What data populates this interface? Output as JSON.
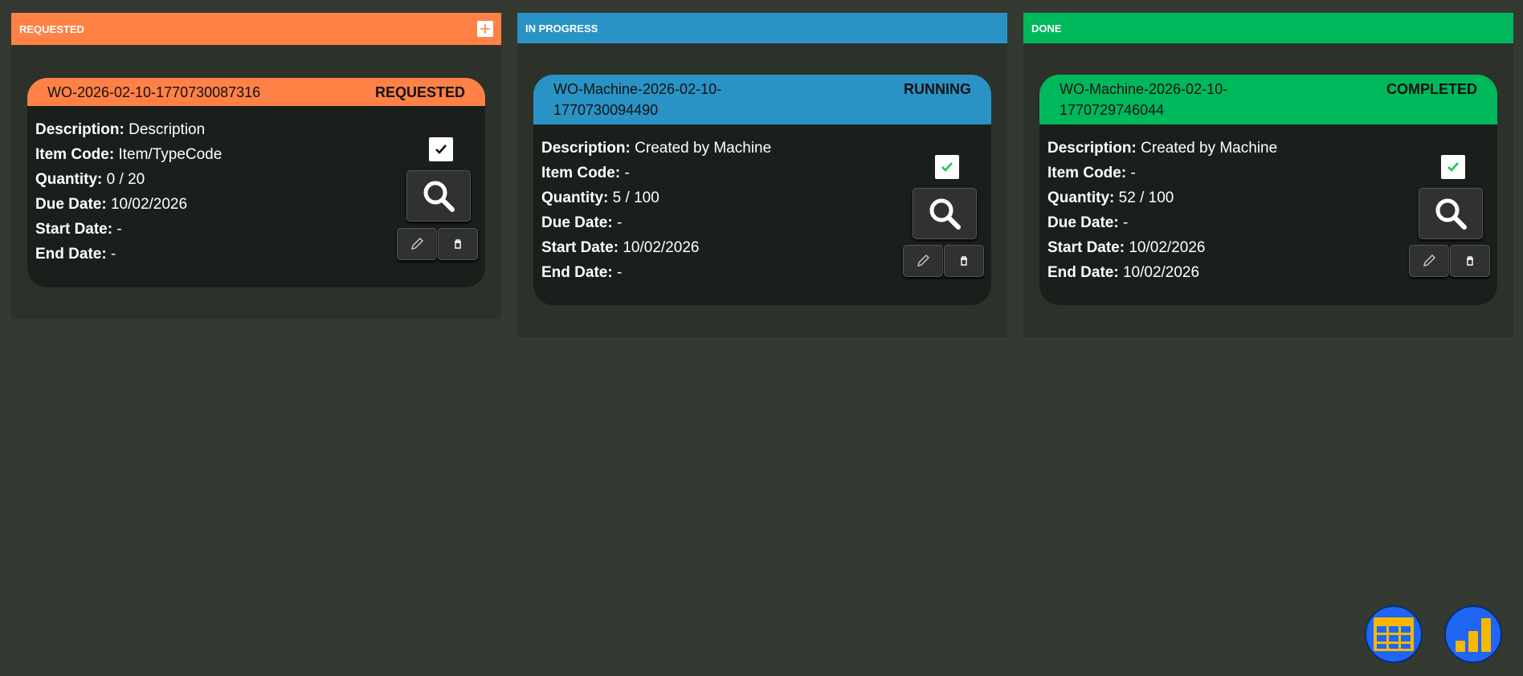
{
  "colors": {
    "requested": "#ff8146",
    "in_progress": "#2a93c6",
    "done": "#00b85c",
    "background": "#343a31"
  },
  "columns": [
    {
      "title": "REQUESTED",
      "card": {
        "wo": "WO-2026-02-10-1770730087316",
        "status": "REQUESTED",
        "description": "Description",
        "item_code": "Item/TypeCode",
        "quantity": "0 / 20",
        "due_date": "10/02/2026",
        "start_date": "-",
        "end_date": "-"
      }
    },
    {
      "title": "IN PROGRESS",
      "card": {
        "wo_line1": "WO-Machine-2026-02-10-",
        "wo_line2": "1770730094490",
        "status": "RUNNING",
        "description": "Created by Machine",
        "item_code": "-",
        "quantity": "5 / 100",
        "due_date": "-",
        "start_date": "10/02/2026",
        "end_date": "-"
      }
    },
    {
      "title": "DONE",
      "card": {
        "wo_line1": "WO-Machine-2026-02-10-",
        "wo_line2": "1770729746044",
        "status": "COMPLETED",
        "description": "Created by Machine",
        "item_code": "-",
        "quantity": "52 / 100",
        "due_date": "-",
        "start_date": "10/02/2026",
        "end_date": "10/02/2026"
      }
    }
  ],
  "labels": {
    "description": "Description:",
    "item_code": "Item Code:",
    "quantity": "Quantity:",
    "due_date": "Due Date:",
    "start_date": "Start Date:",
    "end_date": "End Date:"
  },
  "icons": {
    "add": "plus-icon",
    "check": "checkmark-icon",
    "search": "magnifier-icon",
    "edit": "pencil-icon",
    "delete": "trash-icon",
    "table_view": "grid-table-icon",
    "chart_view": "bar-chart-icon"
  }
}
